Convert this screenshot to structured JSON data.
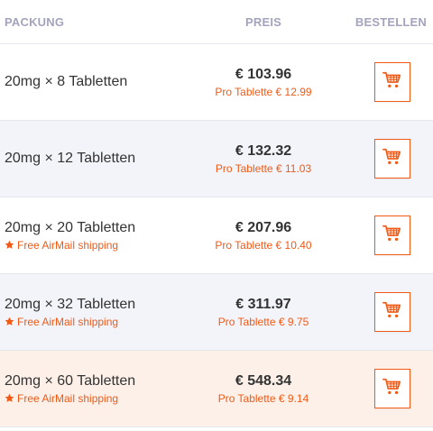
{
  "header": {
    "package": "PACKUNG",
    "price": "PREIS",
    "order": "BESTELLEN"
  },
  "colors": {
    "accent": "#f05a16",
    "header_text": "#a3a3bd",
    "row_alt": "#f3f4fa",
    "row_highlight": "#fdf0e8"
  },
  "rows": [
    {
      "package": "20mg × 8 Tabletten",
      "shipping": "",
      "price": "€ 103.96",
      "per_tablet": "Pro Tablette € 12.99",
      "icon": "cart-icon"
    },
    {
      "package": "20mg × 12 Tabletten",
      "shipping": "",
      "price": "€ 132.32",
      "per_tablet": "Pro Tablette € 11.03",
      "icon": "cart-icon"
    },
    {
      "package": "20mg × 20 Tabletten",
      "shipping": "Free AirMail shipping",
      "price": "€ 207.96",
      "per_tablet": "Pro Tablette € 10.40",
      "icon": "cart-icon"
    },
    {
      "package": "20mg × 32 Tabletten",
      "shipping": "Free AirMail shipping",
      "price": "€ 311.97",
      "per_tablet": "Pro Tablette € 9.75",
      "icon": "cart-icon"
    },
    {
      "package": "20mg × 60 Tabletten",
      "shipping": "Free AirMail shipping",
      "price": "€ 548.34",
      "per_tablet": "Pro Tablette € 9.14",
      "icon": "cart-icon"
    }
  ]
}
